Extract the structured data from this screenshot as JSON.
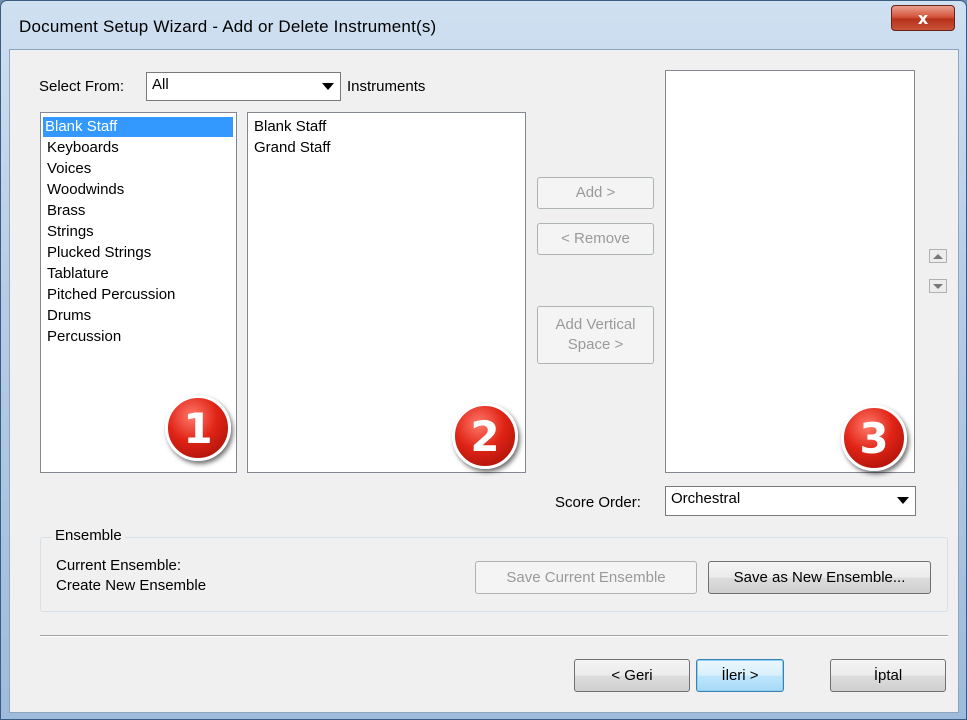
{
  "window": {
    "title": "Document Setup Wizard - Add or Delete Instrument(s)",
    "close_glyph": "x"
  },
  "select_from": {
    "label": "Select From:",
    "value": "All"
  },
  "instruments_label": "Instruments",
  "categories": [
    "Blank Staff",
    "Keyboards",
    "Voices",
    "Woodwinds",
    "Brass",
    "Strings",
    "Plucked Strings",
    "Tablature",
    "Pitched Percussion",
    "Drums",
    "Percussion"
  ],
  "selected_category": "Blank Staff",
  "instruments": [
    "Blank Staff",
    "Grand Staff"
  ],
  "buttons": {
    "add": "Add >",
    "remove": "< Remove",
    "add_vertical_space_line1": "Add Vertical",
    "add_vertical_space_line2": "Space >",
    "save_current": "Save Current Ensemble",
    "save_new": "Save as New Ensemble...",
    "back": "< Geri",
    "next": "İleri >",
    "cancel": "İptal"
  },
  "badges": [
    "1",
    "2",
    "3"
  ],
  "score_order": {
    "label": "Score Order:",
    "value": "Orchestral"
  },
  "ensemble": {
    "title": "Ensemble",
    "current_label": "Current Ensemble:",
    "current_value": "Create New Ensemble"
  },
  "colors": {
    "selection": "#3399ff",
    "badge": "#e02416"
  }
}
